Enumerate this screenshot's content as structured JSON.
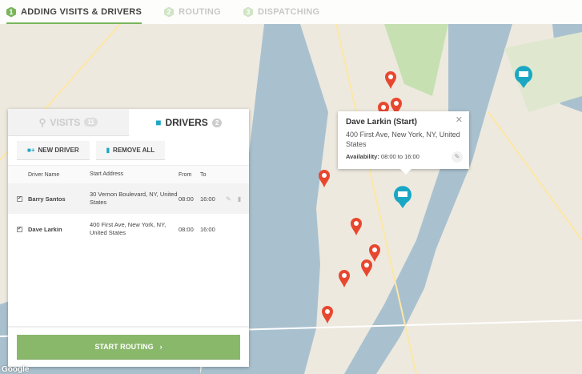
{
  "steps": [
    {
      "num": "1",
      "label": "ADDING VISITS & DRIVERS"
    },
    {
      "num": "2",
      "label": "ROUTING"
    },
    {
      "num": "3",
      "label": "DISPATCHING"
    }
  ],
  "tabs": {
    "visits": {
      "label": "VISITS",
      "count": "11"
    },
    "drivers": {
      "label": "DRIVERS",
      "count": "2"
    }
  },
  "actions": {
    "new_driver": "NEW DRIVER",
    "remove_all": "REMOVE ALL"
  },
  "table": {
    "headers": [
      "Driver Name",
      "Start Address",
      "From",
      "To"
    ],
    "rows": [
      {
        "name": "Barry Santos",
        "address": "30 Vernon Boulevard, NY, United States",
        "from": "08:00",
        "to": "16:00"
      },
      {
        "name": "Dave Larkin",
        "address": "400 First Ave, New York, NY, United States",
        "from": "08:00",
        "to": "16:00"
      }
    ]
  },
  "start_routing": "START ROUTING",
  "popup": {
    "title": "Dave Larkin (Start)",
    "address": "400 First Ave, New York, NY, United States",
    "availability_label": "Availability:",
    "availability": "08:00 to 16:00"
  },
  "google": "Google",
  "colors": {
    "accent": "#7ab55c",
    "driver": "#1aa7c4",
    "pin": "#e8472f"
  }
}
